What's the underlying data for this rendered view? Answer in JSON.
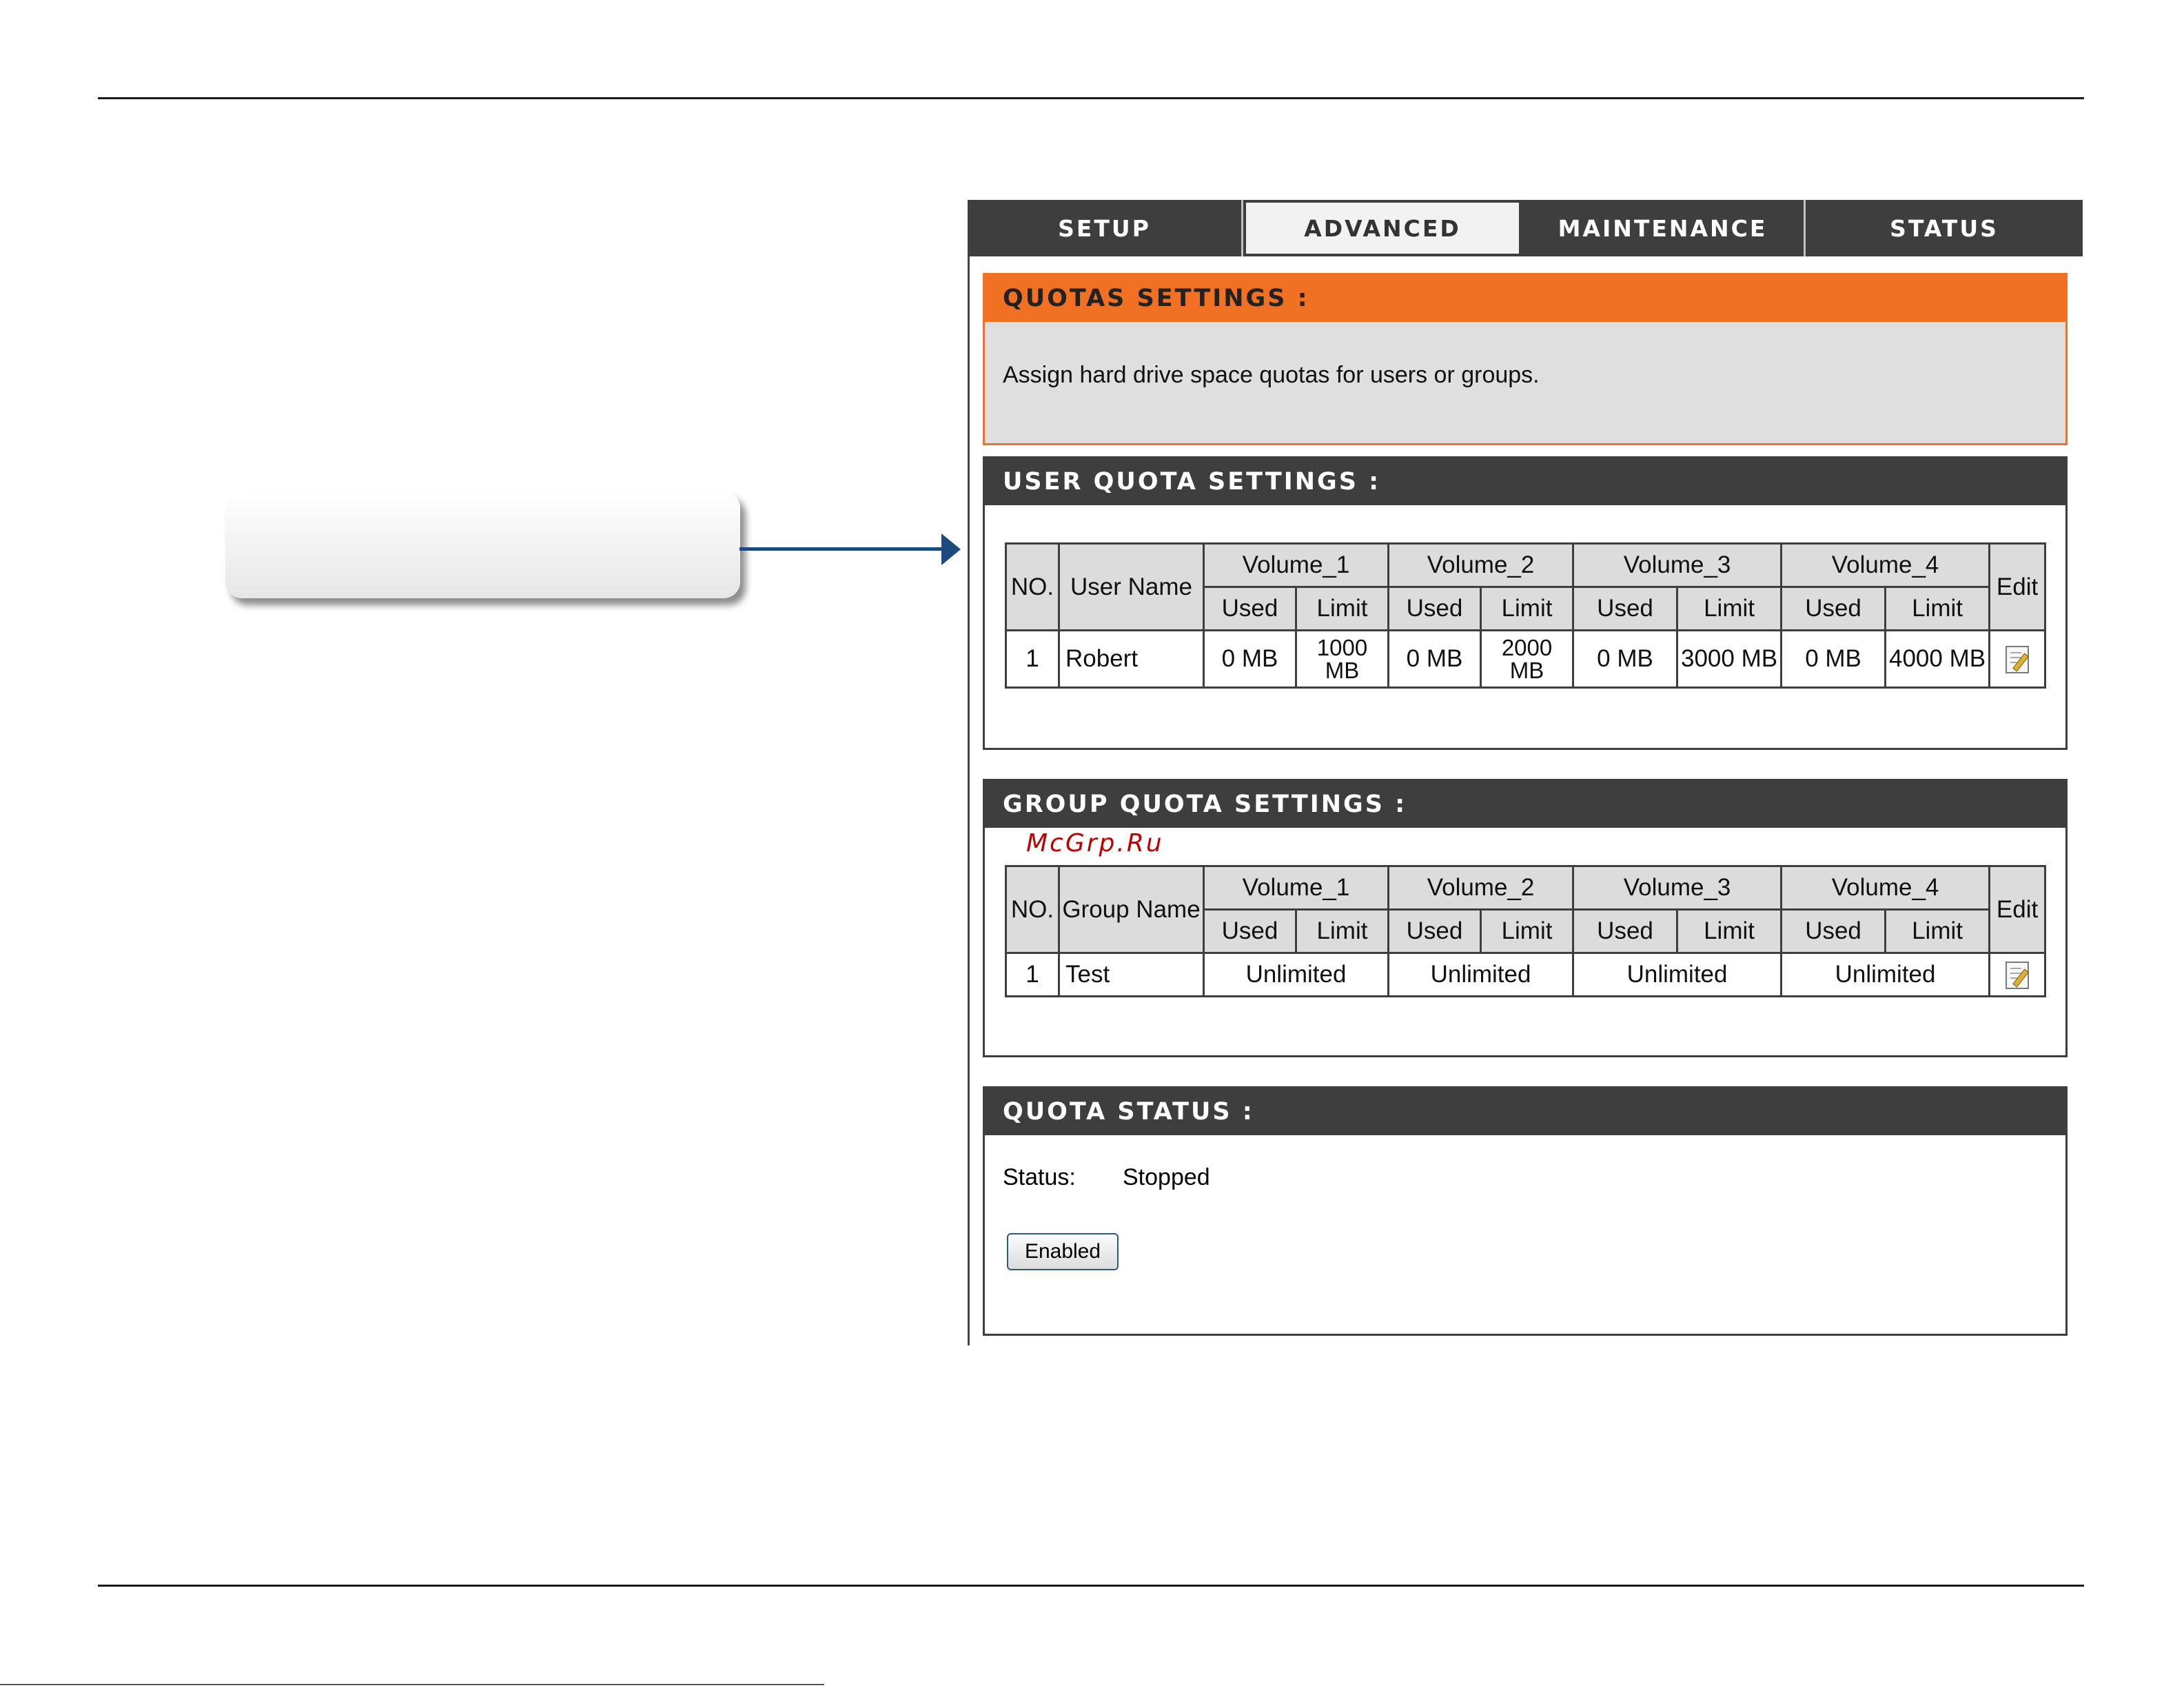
{
  "tabs": [
    "SETUP",
    "ADVANCED",
    "MAINTENANCE",
    "STATUS"
  ],
  "active_tab": "ADVANCED",
  "quotas": {
    "title": "QUOTAS SETTINGS :",
    "description": "Assign hard drive space quotas for users or groups."
  },
  "user_quota": {
    "title": "USER QUOTA SETTINGS :",
    "headers": {
      "no": "NO.",
      "name": "User Name",
      "volumes": [
        "Volume_1",
        "Volume_2",
        "Volume_3",
        "Volume_4"
      ],
      "used": "Used",
      "limit": "Limit",
      "edit": "Edit"
    },
    "rows": [
      {
        "no": "1",
        "name": "Robert",
        "v1_used": "0 MB",
        "v1_limit": "1000 MB",
        "v2_used": "0 MB",
        "v2_limit": "2000 MB",
        "v3_used": "0 MB",
        "v3_limit": "3000 MB",
        "v4_used": "0 MB",
        "v4_limit": "4000 MB"
      }
    ]
  },
  "group_quota": {
    "title": "GROUP QUOTA SETTINGS :",
    "watermark": "McGrp.Ru",
    "headers": {
      "no": "NO.",
      "name": "Group Name",
      "volumes": [
        "Volume_1",
        "Volume_2",
        "Volume_3",
        "Volume_4"
      ],
      "used": "Used",
      "limit": "Limit",
      "edit": "Edit"
    },
    "rows": [
      {
        "no": "1",
        "name": "Test",
        "v1": "Unlimited",
        "v2": "Unlimited",
        "v3": "Unlimited",
        "v4": "Unlimited"
      }
    ]
  },
  "quota_status": {
    "title": "QUOTA STATUS :",
    "status_label": "Status:",
    "status_value": "Stopped",
    "button_label": "Enabled"
  },
  "colors": {
    "accent": "#f07024",
    "header": "#3e3e3e",
    "arrow": "#1c4a7e",
    "watermark": "#c00000"
  },
  "icons": [
    "edit-icon"
  ]
}
